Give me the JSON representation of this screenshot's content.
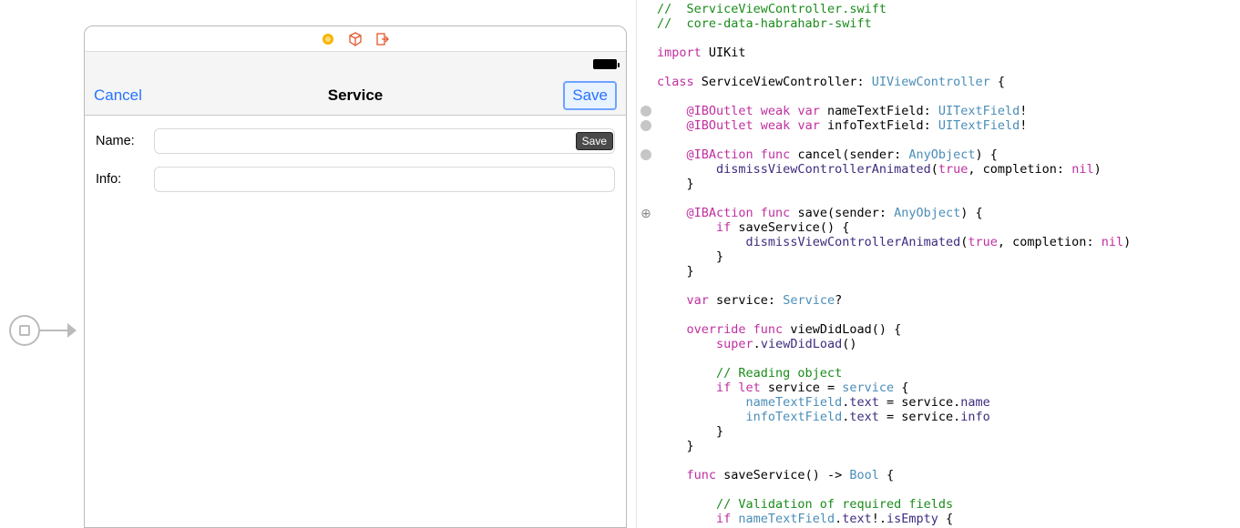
{
  "nav": {
    "cancel": "Cancel",
    "title": "Service",
    "save": "Save",
    "tooltip": "Save"
  },
  "form": {
    "name_label": "Name:",
    "info_label": "Info:",
    "name_value": "",
    "info_value": ""
  },
  "code": {
    "l1a": "//  ",
    "l1b": "ServiceViewController.swift",
    "l2a": "//  ",
    "l2b": "core-data-habrahabr-swift",
    "l4a": "import",
    "l4b": " UIKit",
    "l6a": "class",
    "l6b": " ServiceViewController: ",
    "l6c": "UIViewController",
    "l6d": " {",
    "l8a": "    @IBOutlet",
    "l8b": " weak",
    "l8c": " var",
    "l8d": " nameTextField: ",
    "l8e": "UITextField",
    "l8f": "!",
    "l9a": "    @IBOutlet",
    "l9b": " weak",
    "l9c": " var",
    "l9d": " infoTextField: ",
    "l9e": "UITextField",
    "l9f": "!",
    "l11a": "    @IBAction",
    "l11b": " func",
    "l11c": " cancel(sender: ",
    "l11d": "AnyObject",
    "l11e": ") {",
    "l12a": "        ",
    "l12b": "dismissViewControllerAnimated",
    "l12c": "(",
    "l12d": "true",
    "l12e": ", completion: ",
    "l12f": "nil",
    "l12g": ")",
    "l13": "    }",
    "l15a": "    @IBAction",
    "l15b": " func",
    "l15c": " save(sender: ",
    "l15d": "AnyObject",
    "l15e": ") {",
    "l16a": "        if",
    "l16b": " saveService() {",
    "l17a": "            ",
    "l17b": "dismissViewControllerAnimated",
    "l17c": "(",
    "l17d": "true",
    "l17e": ", completion: ",
    "l17f": "nil",
    "l17g": ")",
    "l18": "        }",
    "l19": "    }",
    "l21a": "    var",
    "l21b": " service: ",
    "l21c": "Service",
    "l21d": "?",
    "l23a": "    override",
    "l23b": " func",
    "l23c": " viewDidLoad() {",
    "l24a": "        super",
    "l24b": ".",
    "l24c": "viewDidLoad",
    "l24d": "()",
    "l26a": "        // Reading object",
    "l27a": "        if",
    "l27b": " let",
    "l27c": " service = ",
    "l27d": "service",
    "l27e": " {",
    "l28a": "            ",
    "l28b": "nameTextField",
    "l28c": ".",
    "l28d": "text",
    "l28e": " = service.",
    "l28f": "name",
    "l29a": "            ",
    "l29b": "infoTextField",
    "l29c": ".",
    "l29d": "text",
    "l29e": " = service.",
    "l29f": "info",
    "l30": "        }",
    "l31": "    }",
    "l33a": "    func",
    "l33b": " saveService() -> ",
    "l33c": "Bool",
    "l33d": " {",
    "l35a": "        // Validation of required fields",
    "l36a": "        if",
    "l36b": " ",
    "l36c": "nameTextField",
    "l36d": ".",
    "l36e": "text",
    "l36f": "!.",
    "l36g": "isEmpty",
    "l36h": " {"
  }
}
